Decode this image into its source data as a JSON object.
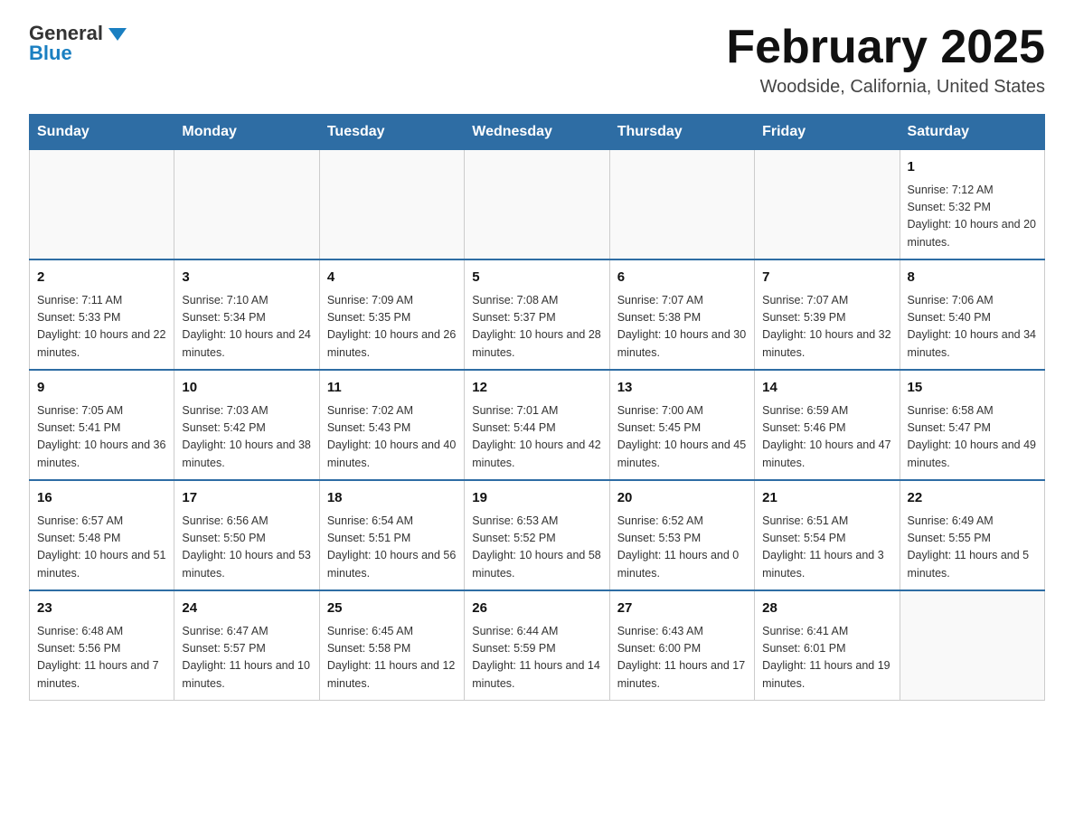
{
  "header": {
    "logo_general": "General",
    "logo_blue": "Blue",
    "month_title": "February 2025",
    "location": "Woodside, California, United States"
  },
  "days_of_week": [
    "Sunday",
    "Monday",
    "Tuesday",
    "Wednesday",
    "Thursday",
    "Friday",
    "Saturday"
  ],
  "weeks": [
    [
      {
        "day": "",
        "info": ""
      },
      {
        "day": "",
        "info": ""
      },
      {
        "day": "",
        "info": ""
      },
      {
        "day": "",
        "info": ""
      },
      {
        "day": "",
        "info": ""
      },
      {
        "day": "",
        "info": ""
      },
      {
        "day": "1",
        "info": "Sunrise: 7:12 AM\nSunset: 5:32 PM\nDaylight: 10 hours and 20 minutes."
      }
    ],
    [
      {
        "day": "2",
        "info": "Sunrise: 7:11 AM\nSunset: 5:33 PM\nDaylight: 10 hours and 22 minutes."
      },
      {
        "day": "3",
        "info": "Sunrise: 7:10 AM\nSunset: 5:34 PM\nDaylight: 10 hours and 24 minutes."
      },
      {
        "day": "4",
        "info": "Sunrise: 7:09 AM\nSunset: 5:35 PM\nDaylight: 10 hours and 26 minutes."
      },
      {
        "day": "5",
        "info": "Sunrise: 7:08 AM\nSunset: 5:37 PM\nDaylight: 10 hours and 28 minutes."
      },
      {
        "day": "6",
        "info": "Sunrise: 7:07 AM\nSunset: 5:38 PM\nDaylight: 10 hours and 30 minutes."
      },
      {
        "day": "7",
        "info": "Sunrise: 7:07 AM\nSunset: 5:39 PM\nDaylight: 10 hours and 32 minutes."
      },
      {
        "day": "8",
        "info": "Sunrise: 7:06 AM\nSunset: 5:40 PM\nDaylight: 10 hours and 34 minutes."
      }
    ],
    [
      {
        "day": "9",
        "info": "Sunrise: 7:05 AM\nSunset: 5:41 PM\nDaylight: 10 hours and 36 minutes."
      },
      {
        "day": "10",
        "info": "Sunrise: 7:03 AM\nSunset: 5:42 PM\nDaylight: 10 hours and 38 minutes."
      },
      {
        "day": "11",
        "info": "Sunrise: 7:02 AM\nSunset: 5:43 PM\nDaylight: 10 hours and 40 minutes."
      },
      {
        "day": "12",
        "info": "Sunrise: 7:01 AM\nSunset: 5:44 PM\nDaylight: 10 hours and 42 minutes."
      },
      {
        "day": "13",
        "info": "Sunrise: 7:00 AM\nSunset: 5:45 PM\nDaylight: 10 hours and 45 minutes."
      },
      {
        "day": "14",
        "info": "Sunrise: 6:59 AM\nSunset: 5:46 PM\nDaylight: 10 hours and 47 minutes."
      },
      {
        "day": "15",
        "info": "Sunrise: 6:58 AM\nSunset: 5:47 PM\nDaylight: 10 hours and 49 minutes."
      }
    ],
    [
      {
        "day": "16",
        "info": "Sunrise: 6:57 AM\nSunset: 5:48 PM\nDaylight: 10 hours and 51 minutes."
      },
      {
        "day": "17",
        "info": "Sunrise: 6:56 AM\nSunset: 5:50 PM\nDaylight: 10 hours and 53 minutes."
      },
      {
        "day": "18",
        "info": "Sunrise: 6:54 AM\nSunset: 5:51 PM\nDaylight: 10 hours and 56 minutes."
      },
      {
        "day": "19",
        "info": "Sunrise: 6:53 AM\nSunset: 5:52 PM\nDaylight: 10 hours and 58 minutes."
      },
      {
        "day": "20",
        "info": "Sunrise: 6:52 AM\nSunset: 5:53 PM\nDaylight: 11 hours and 0 minutes."
      },
      {
        "day": "21",
        "info": "Sunrise: 6:51 AM\nSunset: 5:54 PM\nDaylight: 11 hours and 3 minutes."
      },
      {
        "day": "22",
        "info": "Sunrise: 6:49 AM\nSunset: 5:55 PM\nDaylight: 11 hours and 5 minutes."
      }
    ],
    [
      {
        "day": "23",
        "info": "Sunrise: 6:48 AM\nSunset: 5:56 PM\nDaylight: 11 hours and 7 minutes."
      },
      {
        "day": "24",
        "info": "Sunrise: 6:47 AM\nSunset: 5:57 PM\nDaylight: 11 hours and 10 minutes."
      },
      {
        "day": "25",
        "info": "Sunrise: 6:45 AM\nSunset: 5:58 PM\nDaylight: 11 hours and 12 minutes."
      },
      {
        "day": "26",
        "info": "Sunrise: 6:44 AM\nSunset: 5:59 PM\nDaylight: 11 hours and 14 minutes."
      },
      {
        "day": "27",
        "info": "Sunrise: 6:43 AM\nSunset: 6:00 PM\nDaylight: 11 hours and 17 minutes."
      },
      {
        "day": "28",
        "info": "Sunrise: 6:41 AM\nSunset: 6:01 PM\nDaylight: 11 hours and 19 minutes."
      },
      {
        "day": "",
        "info": ""
      }
    ]
  ]
}
